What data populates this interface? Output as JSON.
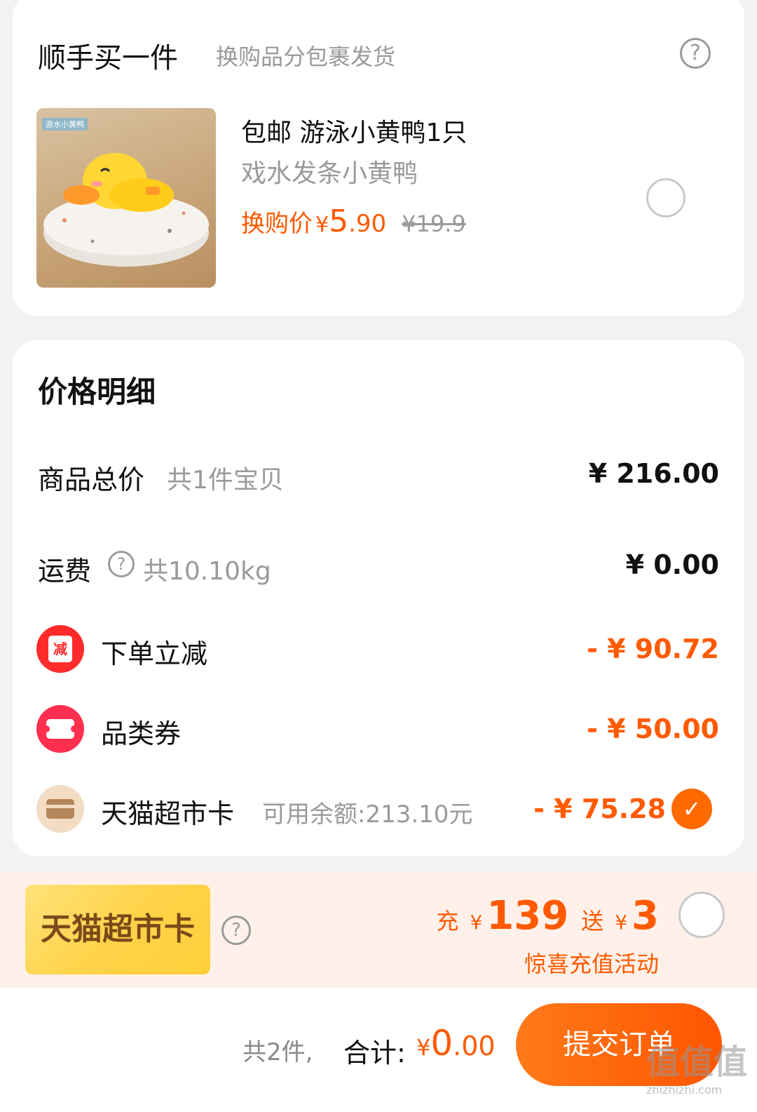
{
  "addon": {
    "title": "顺手买一件",
    "subtitle": "换购品分包裹发货",
    "help_icon": "question-circle-icon",
    "product": {
      "tag": "游水小黄鸭",
      "title": "包邮 游泳小黄鸭1只",
      "subtitle": "戏水发条小黄鸭",
      "price_label": "换购价",
      "yen": "¥",
      "price_int": "5",
      "price_dec": ".90",
      "original_price": "¥19.9",
      "selected": false
    }
  },
  "price_detail": {
    "title": "价格明细",
    "rows": {
      "goods_total": {
        "label": "商品总价",
        "sub": "共1件宝贝",
        "value": "¥ 216.00"
      },
      "shipping": {
        "label": "运费",
        "sub": "共10.10kg",
        "value": "¥ 0.00",
        "icon": "question-circle-icon"
      },
      "instant_discount": {
        "label": "下单立减",
        "value": "- ¥ 90.72",
        "icon": "reduce-badge-icon",
        "icon_text": "减"
      },
      "category_coupon": {
        "label": "品类券",
        "value": "- ¥ 50.00",
        "icon": "ticket-icon"
      },
      "supermarket_card": {
        "label": "天猫超市卡",
        "sub": "可用余额:213.10元",
        "value": "- ¥ 75.28",
        "icon": "card-icon",
        "checked": true
      }
    }
  },
  "promo": {
    "card_label": "天猫超市卡",
    "recharge_prefix": "充",
    "yen": "¥",
    "recharge_amount": "139",
    "bonus_prefix": "送",
    "bonus_amount": "3",
    "note": "惊喜充值活动",
    "selected": false
  },
  "bottom_bar": {
    "count": "共2件,",
    "total_label": "合计:",
    "yen": "¥",
    "total_int": "0",
    "total_dec": ".00",
    "submit": "提交订单"
  },
  "watermark": {
    "text": "值值值",
    "sub": "zhizhizhi.com"
  },
  "colors": {
    "accent": "#ff5a00",
    "background": "#f2f2f2",
    "promo_bg": "#fff1ea"
  }
}
